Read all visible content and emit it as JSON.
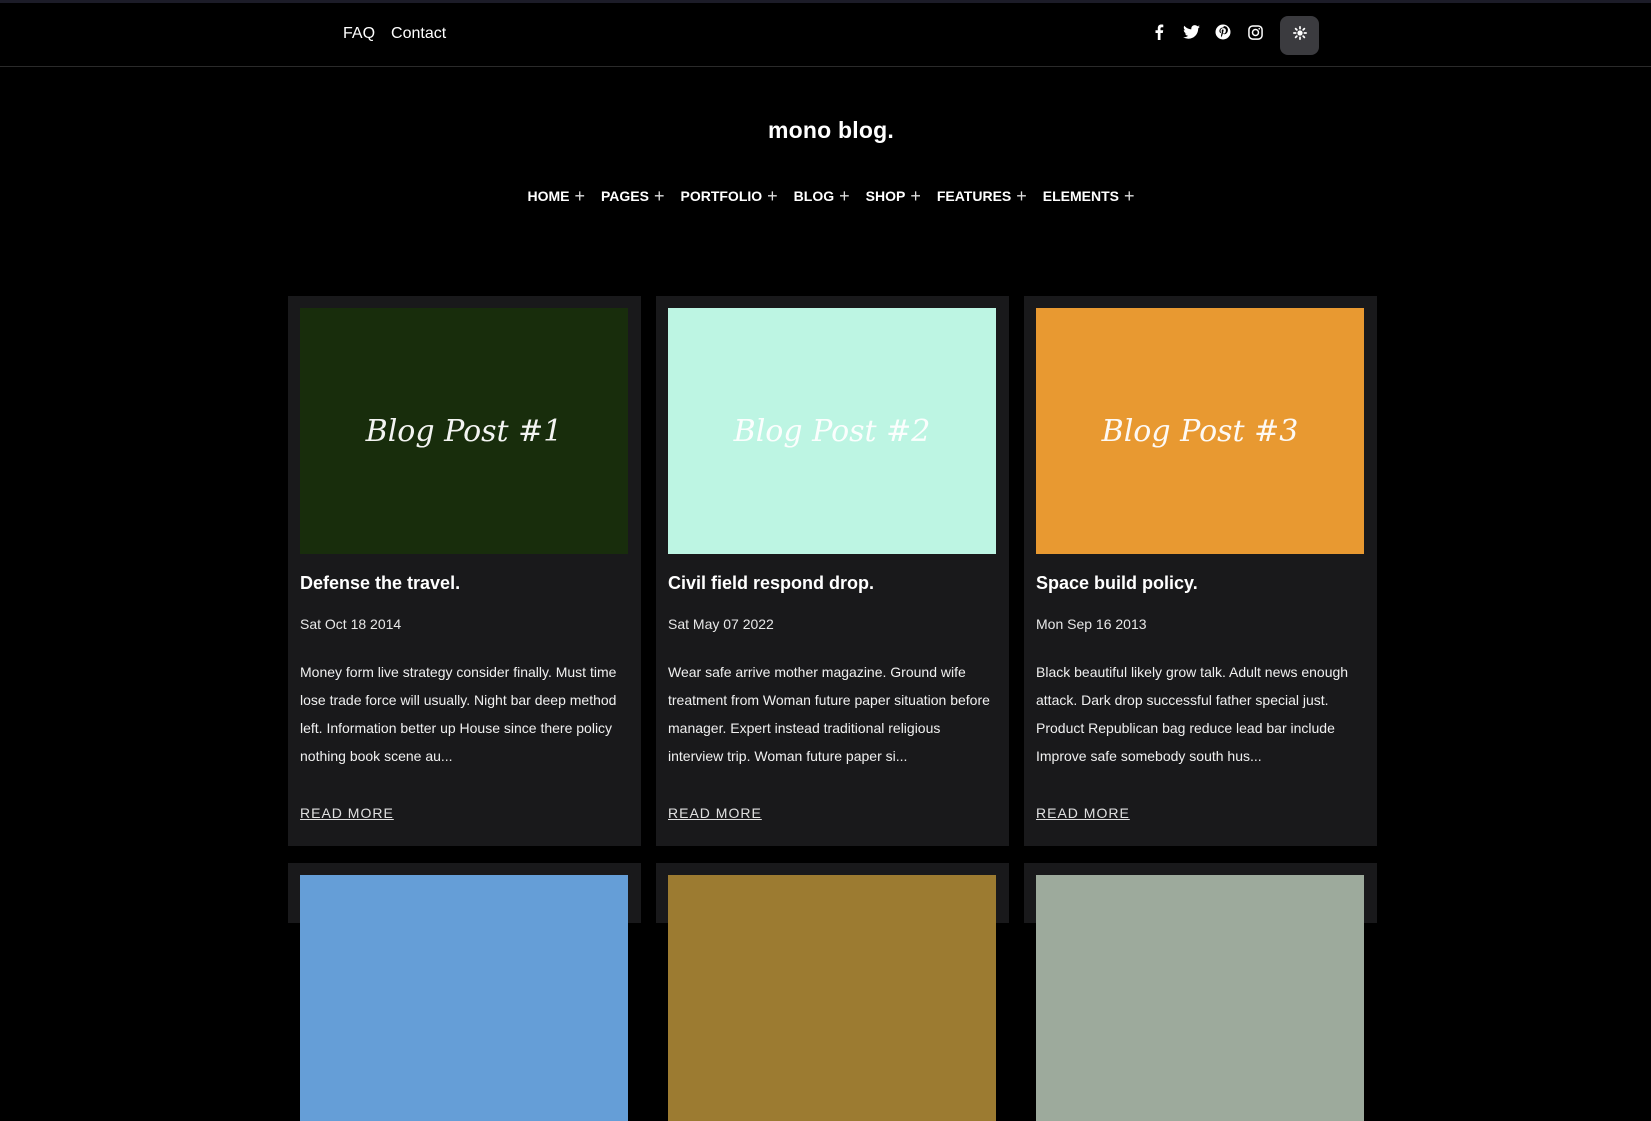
{
  "topbar": {
    "links": [
      "FAQ",
      "Contact"
    ],
    "socials": [
      "facebook-icon",
      "twitter-icon",
      "pinterest-icon",
      "instagram-icon"
    ],
    "theme_toggle": "gear-icon"
  },
  "logo": "mono blog.",
  "nav": [
    {
      "label": "HOME"
    },
    {
      "label": "PAGES"
    },
    {
      "label": "PORTFOLIO"
    },
    {
      "label": "BLOG"
    },
    {
      "label": "SHOP"
    },
    {
      "label": "FEATURES"
    },
    {
      "label": "ELEMENTS"
    }
  ],
  "posts": [
    {
      "thumb_label": "Blog Post #1",
      "thumb_color": "#182d0c",
      "title": "Defense the travel.",
      "date": "Sat Oct 18 2014",
      "excerpt": "Money form live strategy consider finally. Must time lose trade force will usually. Night bar deep method left. Information better up House since there policy nothing book scene au...",
      "read_more": "READ MORE"
    },
    {
      "thumb_label": "Blog Post #2",
      "thumb_color": "#bdf5e3",
      "title": "Civil field respond drop.",
      "date": "Sat May 07 2022",
      "excerpt": "Wear safe arrive mother magazine. Ground wife treatment from Woman future paper situation before manager. Expert instead traditional religious interview trip. Woman future paper si...",
      "read_more": "READ MORE"
    },
    {
      "thumb_label": "Blog Post #3",
      "thumb_color": "#e89931",
      "title": "Space build policy.",
      "date": "Mon Sep 16 2013",
      "excerpt": "Black beautiful likely grow talk. Adult news enough attack. Dark drop successful father special just. Product Republican bag reduce lead bar include Improve safe somebody south hus...",
      "read_more": "READ MORE"
    }
  ],
  "more_posts_colors": [
    "#659ed7",
    "#9c7b31",
    "#9daa9c"
  ]
}
